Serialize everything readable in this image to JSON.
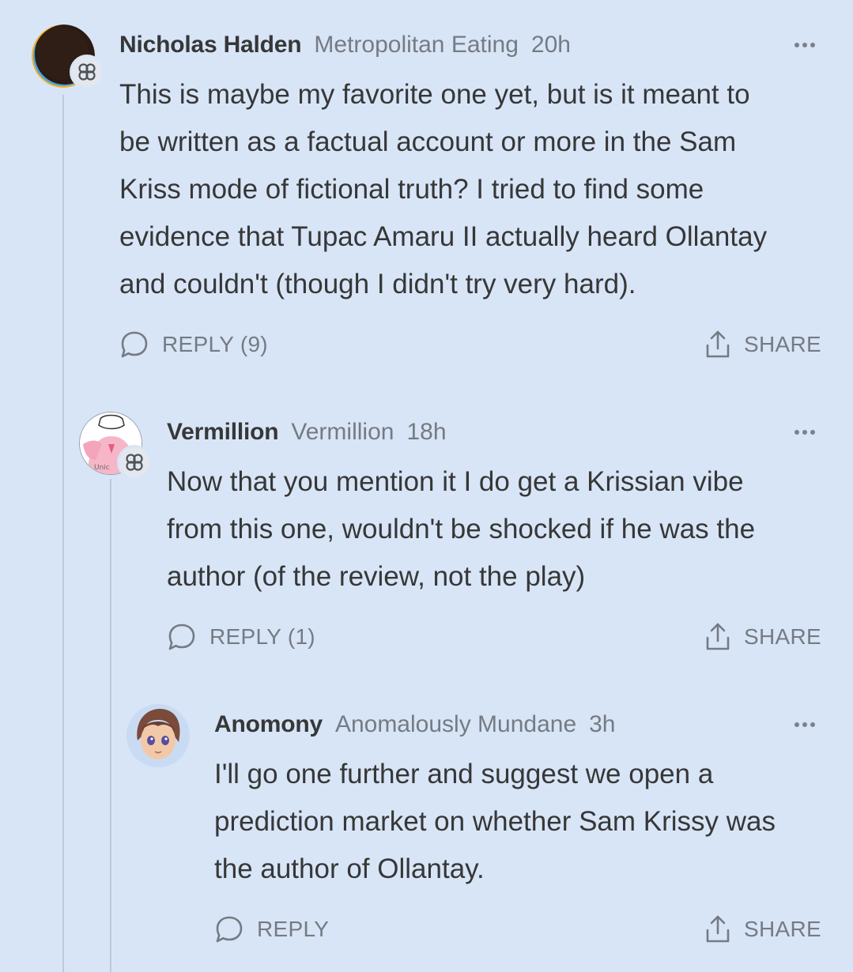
{
  "comments": [
    {
      "author": "Nicholas Halden",
      "publication": "Metropolitan Eating",
      "time": "20h",
      "lines": [
        "This is maybe my favorite one yet, but is it meant to",
        "be written as a factual account or more in the Sam",
        "Kriss mode of fictional truth? I tried to find some",
        "evidence that Tupac Amaru II actually heard Ollantay",
        "and couldn't (though I didn't try very hard)."
      ],
      "reply_label": "REPLY (9)",
      "share_label": "SHARE",
      "avatar_icon": "dark-circle-avatar",
      "badge_icon": "subscriber-badge-icon"
    },
    {
      "author": "Vermillion",
      "publication": "Vermillion",
      "time": "18h",
      "lines": [
        "Now that you mention it I do get a Krissian vibe",
        "from this one, wouldn't be shocked if he was the",
        "author (of the review, not the play)"
      ],
      "reply_label": "REPLY (1)",
      "share_label": "SHARE",
      "avatar_icon": "pink-sweater-avatar",
      "badge_icon": "subscriber-badge-icon"
    },
    {
      "author": "Anomony",
      "publication": "Anomalously Mundane",
      "time": "3h",
      "lines": [
        "I'll go one further and suggest we open a",
        "prediction market on whether Sam Krissy was",
        "the author of Ollantay."
      ],
      "reply_label": "REPLY",
      "share_label": "SHARE",
      "avatar_icon": "anime-character-avatar"
    }
  ],
  "colors": {
    "background": "#d8e5f7",
    "text": "#363737",
    "muted": "#757b83",
    "thread_line": "#bfc9d6"
  }
}
